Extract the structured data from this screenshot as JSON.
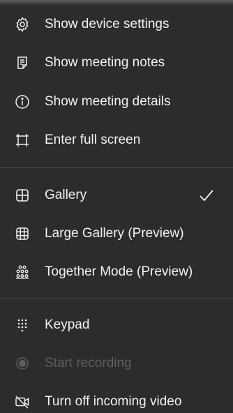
{
  "menu": {
    "items": [
      {
        "label": "Show device settings",
        "icon": "gear-icon"
      },
      {
        "label": "Show meeting notes",
        "icon": "notes-icon"
      },
      {
        "label": "Show meeting details",
        "icon": "info-icon"
      },
      {
        "label": "Enter full screen",
        "icon": "fullscreen-icon"
      },
      {
        "label": "Gallery",
        "icon": "gallery-icon",
        "checked": true
      },
      {
        "label": "Large Gallery (Preview)",
        "icon": "large-gallery-icon"
      },
      {
        "label": "Together Mode (Preview)",
        "icon": "together-mode-icon"
      },
      {
        "label": "Keypad",
        "icon": "keypad-icon"
      },
      {
        "label": "Start recording",
        "icon": "record-icon",
        "disabled": true
      },
      {
        "label": "Turn off incoming video",
        "icon": "video-off-icon"
      }
    ]
  },
  "colors": {
    "background": "#2d2c2c",
    "text": "#f2f2f2",
    "disabled_text": "#5e5e5e",
    "divider": "#4a4a4a"
  }
}
